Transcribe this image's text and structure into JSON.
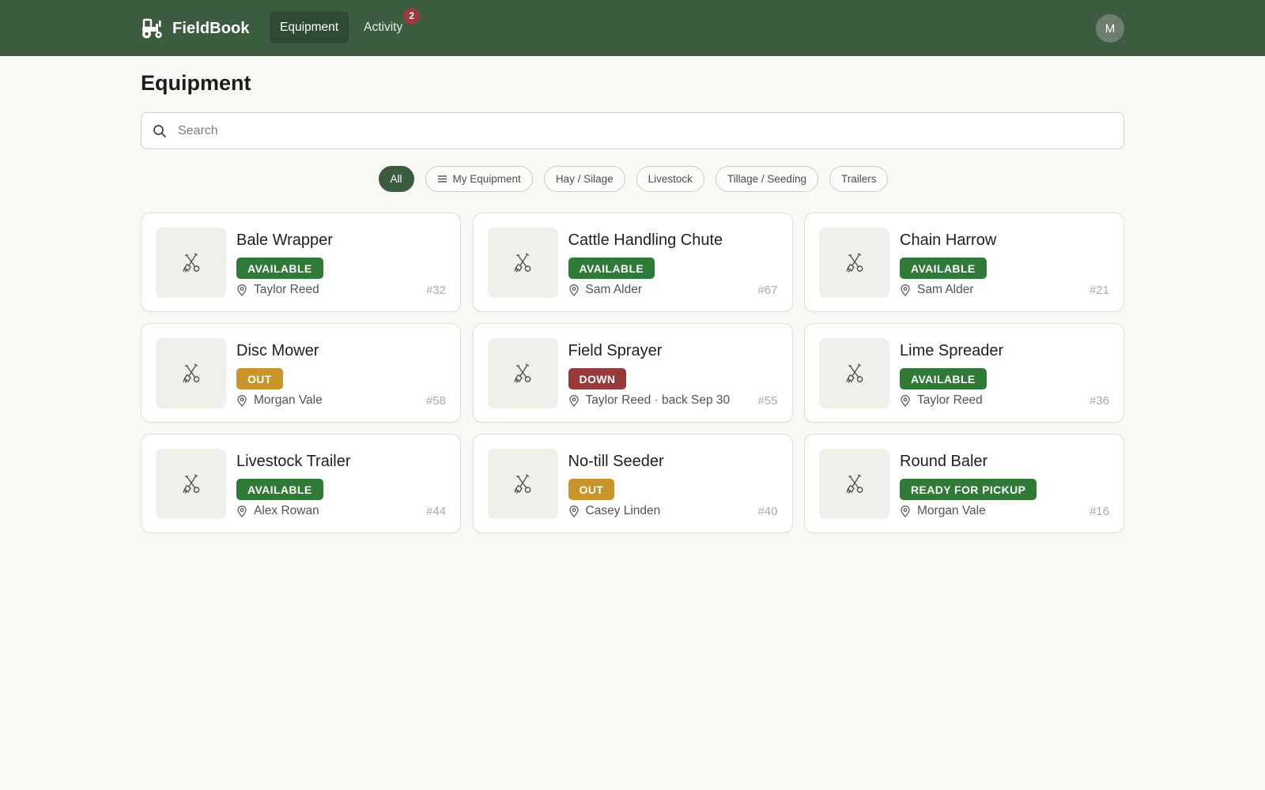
{
  "app": {
    "name": "FieldBook",
    "logo_icon": "tractor-icon"
  },
  "nav": {
    "items": [
      {
        "label": "Equipment",
        "active": true
      },
      {
        "label": "Activity",
        "badge": "2"
      }
    ]
  },
  "user": {
    "avatar_initial": "M"
  },
  "page": {
    "title": "Equipment"
  },
  "search": {
    "placeholder": "Search",
    "value": ""
  },
  "filters": [
    {
      "label": "All",
      "active": true
    },
    {
      "label": "My Equipment",
      "icon": "list-icon"
    },
    {
      "label": "Hay / Silage"
    },
    {
      "label": "Livestock"
    },
    {
      "label": "Tillage / Seeding"
    },
    {
      "label": "Trailers"
    }
  ],
  "equipment": [
    {
      "name": "Bale Wrapper",
      "status": "AVAILABLE",
      "status_kind": "available",
      "owner": "Taylor Reed",
      "number": "#32"
    },
    {
      "name": "Cattle Handling Chute",
      "status": "AVAILABLE",
      "status_kind": "available",
      "owner": "Sam Alder",
      "number": "#67"
    },
    {
      "name": "Chain Harrow",
      "status": "AVAILABLE",
      "status_kind": "available",
      "owner": "Sam Alder",
      "number": "#21"
    },
    {
      "name": "Disc Mower",
      "status": "OUT",
      "status_kind": "out",
      "owner": "Morgan Vale",
      "number": "#58"
    },
    {
      "name": "Field Sprayer",
      "status": "DOWN",
      "status_kind": "down",
      "owner": "Taylor Reed · back Sep 30",
      "number": "#55"
    },
    {
      "name": "Lime Spreader",
      "status": "AVAILABLE",
      "status_kind": "available",
      "owner": "Taylor Reed",
      "number": "#36"
    },
    {
      "name": "Livestock Trailer",
      "status": "AVAILABLE",
      "status_kind": "available",
      "owner": "Alex Rowan",
      "number": "#44"
    },
    {
      "name": "No-till Seeder",
      "status": "OUT",
      "status_kind": "out",
      "owner": "Casey Linden",
      "number": "#40"
    },
    {
      "name": "Round Baler",
      "status": "READY FOR PICKUP",
      "status_kind": "pickup",
      "owner": "Morgan Vale",
      "number": "#16"
    }
  ],
  "icons": {
    "card_thumbnail": "fork-and-shovel-icon",
    "card_location": "map-pin-icon",
    "search": "search-icon"
  },
  "colors": {
    "header": "#3b5c3f",
    "available": "#2f7a36",
    "out": "#c9952a",
    "down": "#983a3a",
    "badge": "#9a3c3c"
  }
}
